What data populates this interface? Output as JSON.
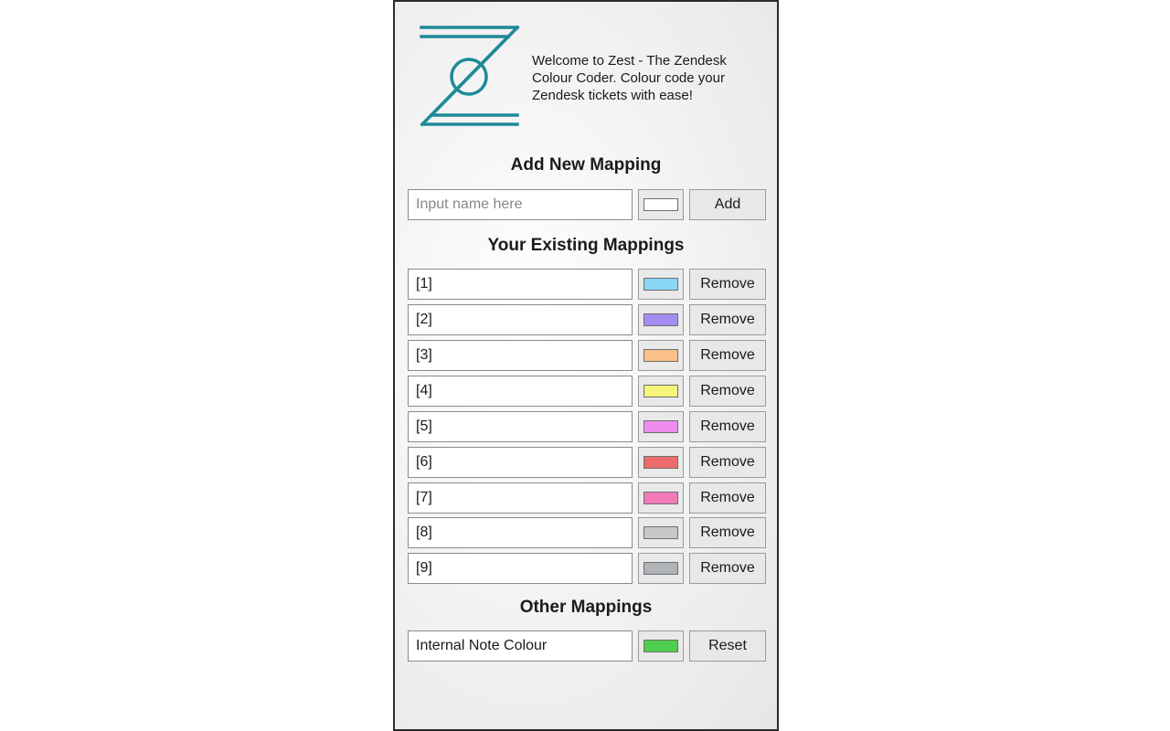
{
  "header": {
    "welcome_text": "Welcome to Zest - The Zendesk Colour Coder. Colour code your Zendesk tickets with ease!",
    "logo_color": "#1e8a96"
  },
  "add_section": {
    "title": "Add New Mapping",
    "name_placeholder": "Input name here",
    "swatch_color": "#ffffff",
    "add_label": "Add"
  },
  "existing_section": {
    "title": "Your Existing Mappings",
    "remove_label": "Remove",
    "mappings": [
      {
        "name": "[1]",
        "color": "#87d7f5"
      },
      {
        "name": "[2]",
        "color": "#a58cf0"
      },
      {
        "name": "[3]",
        "color": "#f9c08a"
      },
      {
        "name": "[4]",
        "color": "#f5f57a"
      },
      {
        "name": "[5]",
        "color": "#ee8cee"
      },
      {
        "name": "[6]",
        "color": "#ee6b6b"
      },
      {
        "name": "[7]",
        "color": "#f27ab6"
      },
      {
        "name": "[8]",
        "color": "#c8c8c8"
      },
      {
        "name": "[9]",
        "color": "#b0b3b7"
      }
    ]
  },
  "other_section": {
    "title": "Other Mappings",
    "internal_note": {
      "name": "Internal Note Colour",
      "color": "#4fcf4f"
    },
    "reset_label": "Reset"
  }
}
